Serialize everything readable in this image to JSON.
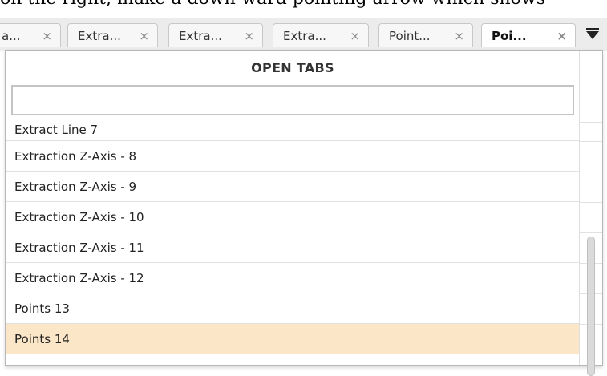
{
  "top_text": "on the right, make a down-ward pointing arrow which shows",
  "tabs": [
    {
      "label": "a...",
      "close": "×",
      "active": false
    },
    {
      "label": "Extra...",
      "close": "×",
      "active": false
    },
    {
      "label": "Extra...",
      "close": "×",
      "active": false
    },
    {
      "label": "Extra...",
      "close": "×",
      "active": false
    },
    {
      "label": "Point...",
      "close": "×",
      "active": false
    },
    {
      "label": "Poi...",
      "close": "×",
      "active": true
    }
  ],
  "dropdown": {
    "title": "OPEN TABS",
    "search_value": "",
    "items": [
      {
        "label": "Extract Line 7",
        "selected": false
      },
      {
        "label": "Extraction Z-Axis - 8",
        "selected": false
      },
      {
        "label": "Extraction Z-Axis - 9",
        "selected": false
      },
      {
        "label": "Extraction Z-Axis - 10",
        "selected": false
      },
      {
        "label": "Extraction Z-Axis - 11",
        "selected": false
      },
      {
        "label": "Extraction Z-Axis - 12",
        "selected": false
      },
      {
        "label": "Points 13",
        "selected": false
      },
      {
        "label": "Points 14",
        "selected": true
      }
    ]
  },
  "colors": {
    "selected_row": "#fbe6c7",
    "tabbar_bg": "#ececec"
  }
}
